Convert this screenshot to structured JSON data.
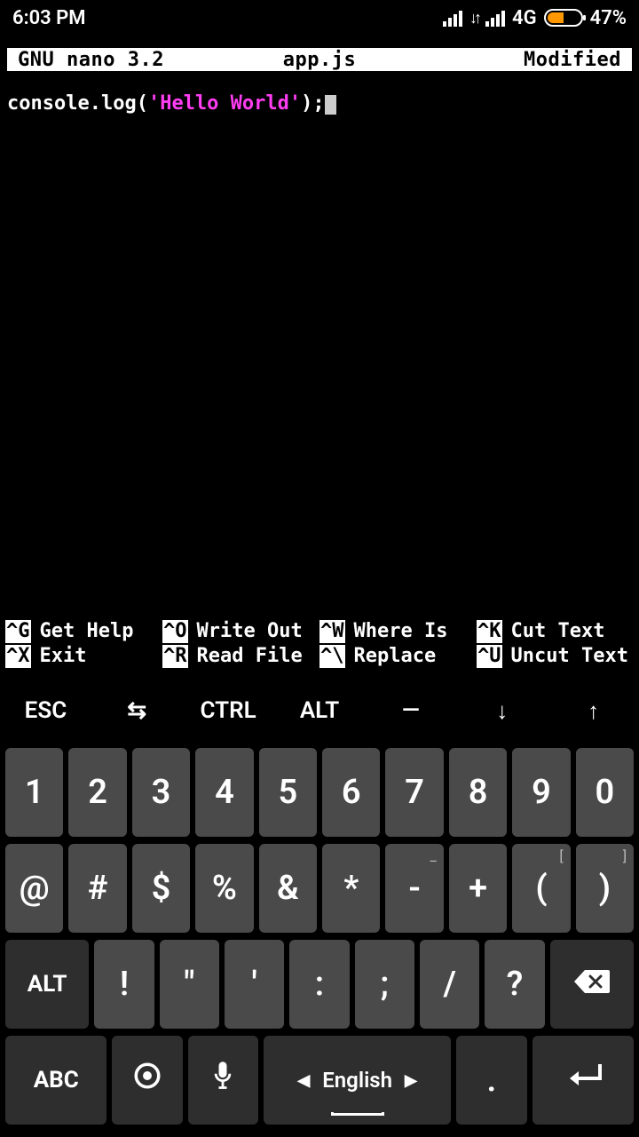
{
  "statusbar": {
    "time": "6:03 PM",
    "network_label": "4G",
    "battery_pct": "47%"
  },
  "nano": {
    "app": "GNU nano 3.2",
    "filename": "app.js",
    "status": "Modified",
    "code_plain_prefix": "console.log(",
    "code_string": "'Hello World'",
    "code_plain_suffix": ");",
    "shortcuts": [
      {
        "key": "^G",
        "label": "Get Help"
      },
      {
        "key": "^O",
        "label": "Write Out"
      },
      {
        "key": "^W",
        "label": "Where Is"
      },
      {
        "key": "^K",
        "label": "Cut Text"
      },
      {
        "key": "^X",
        "label": "Exit"
      },
      {
        "key": "^R",
        "label": "Read File"
      },
      {
        "key": "^\\",
        "label": "Replace"
      },
      {
        "key": "^U",
        "label": "Uncut Text"
      }
    ]
  },
  "extra_keys": {
    "esc": "ESC",
    "tab": "⇆",
    "ctrl": "CTRL",
    "alt": "ALT",
    "dash": "—",
    "down": "↓",
    "up": "↑"
  },
  "keyboard": {
    "row1": [
      {
        "main": "1"
      },
      {
        "main": "2"
      },
      {
        "main": "3"
      },
      {
        "main": "4"
      },
      {
        "main": "5"
      },
      {
        "main": "6"
      },
      {
        "main": "7"
      },
      {
        "main": "8"
      },
      {
        "main": "9"
      },
      {
        "main": "0"
      }
    ],
    "row2": [
      {
        "main": "@"
      },
      {
        "main": "#"
      },
      {
        "main": "$"
      },
      {
        "main": "%"
      },
      {
        "main": "&"
      },
      {
        "main": "*"
      },
      {
        "main": "-",
        "sub": "_"
      },
      {
        "main": "+"
      },
      {
        "main": "(",
        "sub": "["
      },
      {
        "main": ")",
        "sub": "]"
      }
    ],
    "row3_alt": "ALT",
    "row3": [
      {
        "main": "!"
      },
      {
        "main": "\""
      },
      {
        "main": "'"
      },
      {
        "main": ":"
      },
      {
        "main": ";"
      },
      {
        "main": "/"
      },
      {
        "main": "?"
      }
    ],
    "row4": {
      "abc": "ABC",
      "lang": "English",
      "period": "."
    }
  }
}
